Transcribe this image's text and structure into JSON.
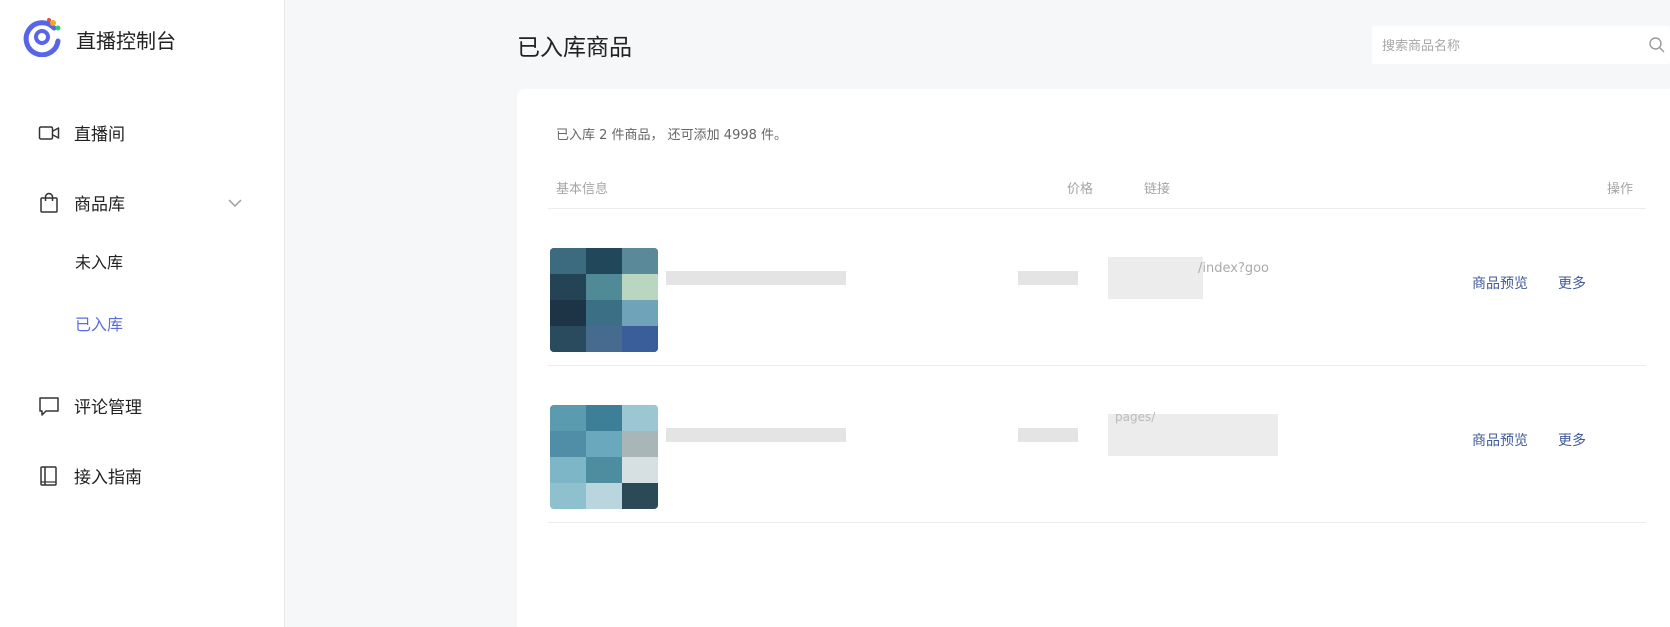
{
  "app": {
    "title": "直播控制台"
  },
  "sidebar": {
    "items": [
      {
        "label": "直播间",
        "icon": "video-camera-icon"
      },
      {
        "label": "商品库",
        "icon": "shopping-bag-icon"
      },
      {
        "label": "评论管理",
        "icon": "comment-icon"
      },
      {
        "label": "接入指南",
        "icon": "book-icon"
      }
    ],
    "subitems": [
      {
        "label": "未入库"
      },
      {
        "label": "已入库",
        "active": true
      }
    ]
  },
  "page": {
    "title": "已入库商品"
  },
  "search": {
    "placeholder": "搜索商品名称"
  },
  "summary": "已入库 2 件商品， 还可添加 4998 件。",
  "table": {
    "headers": [
      "基本信息",
      "价格",
      "链接",
      "操作"
    ],
    "rows": [
      {
        "link_fragment": "/index?goo",
        "actions": [
          "商品预览",
          "更多"
        ]
      },
      {
        "link_fragment": "pages/",
        "actions": [
          "商品预览",
          "更多"
        ]
      }
    ]
  },
  "colors": {
    "accent": "#5b6be0",
    "action_link": "#3f5a9a",
    "background": "#f6f7f8"
  }
}
